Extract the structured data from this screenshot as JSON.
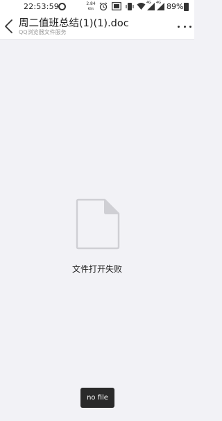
{
  "status_bar": {
    "time": "22:53:59",
    "net_speed_value": "2.84",
    "net_speed_unit": "KB/s",
    "network_label_1": "4G",
    "network_label_2": "4G",
    "battery": "89%"
  },
  "header": {
    "title": "周二值班总结(1)(1).doc",
    "subtitle": "QQ浏览器文件服务"
  },
  "main": {
    "error_message": "文件打开失败"
  },
  "toast": {
    "text": "no file"
  },
  "colors": {
    "background": "#f2f2f6",
    "header_bg": "#ffffff",
    "icon_gray": "#cfcfd4",
    "toast_bg": "#2a2a2a"
  }
}
